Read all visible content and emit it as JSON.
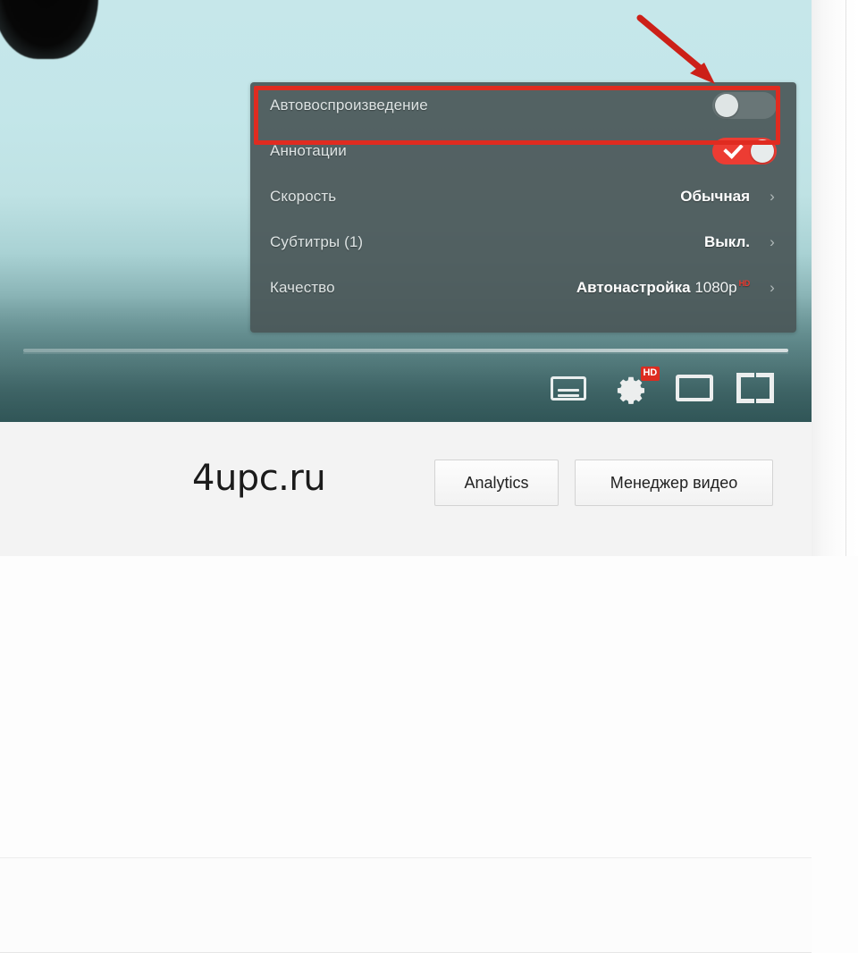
{
  "player": {
    "settings_menu": {
      "rows": [
        {
          "id": "autoplay",
          "label": "Автовоспроизведение",
          "control": "toggle",
          "state": "off",
          "value": ""
        },
        {
          "id": "annotations",
          "label": "Аннотации",
          "control": "toggle",
          "state": "on",
          "value": ""
        },
        {
          "id": "speed",
          "label": "Скорость",
          "control": "chevron",
          "value": "Обычная",
          "chevron": "›"
        },
        {
          "id": "subtitles",
          "label": "Субтитры (1)",
          "control": "chevron",
          "value": "Выкл.",
          "chevron": "›"
        },
        {
          "id": "quality",
          "label": "Качество",
          "control": "chevron",
          "value": "Автонастройка",
          "value_sub": "1080p",
          "badge": "HD",
          "chevron": "›"
        }
      ]
    },
    "controls": {
      "subtitles_icon": "subtitles-icon",
      "settings_icon": "gear-icon",
      "settings_badge": "HD",
      "theater_icon": "theater-mode-icon",
      "fullscreen_icon": "fullscreen-icon"
    }
  },
  "annotation": {
    "highlight_color": "#e02b20",
    "arrow_color": "#cc2018",
    "target": "autoplay"
  },
  "page": {
    "watermark": "4upc.ru",
    "buttons": [
      {
        "id": "analytics",
        "label": "Analytics"
      },
      {
        "id": "video-manager",
        "label": "Менеджер видео"
      }
    ]
  },
  "colors": {
    "panel_bg": "#4a5758",
    "toggle_on": "#ec3c33",
    "badge_red": "#dd2c20",
    "video_top": "#c6e7ea",
    "video_bottom": "#31585a"
  }
}
